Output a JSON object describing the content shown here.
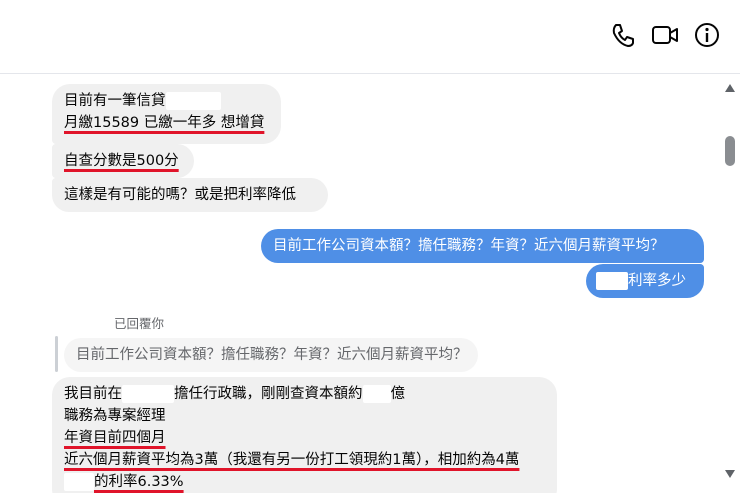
{
  "header": {
    "icons": [
      "phone-icon",
      "video-call-icon",
      "info-icon"
    ]
  },
  "messages": {
    "m1_line1": "目前有一筆信貸",
    "m1_line2": "月繳15589 已繳一年多 想增貸",
    "m2": "自查分數是500分",
    "m3": "這樣是有可能的嗎？或是把利率降低",
    "m4": "目前工作公司資本額？擔任職務？年資？近六個月薪資平均？",
    "m5": "利率多少",
    "replied_label": "已回覆你",
    "quoted": "目前工作公司資本額？擔任職務？年資？近六個月薪資平均？",
    "r_line1_a": "我目前在",
    "r_line1_b": "擔任行政職，剛剛查資本額約",
    "r_line1_c": "億",
    "r_line2": "職務為專案經理",
    "r_line3": "年資目前四個月",
    "r_line4": "近六個月薪資平均為3萬（我還有另一份打工領現約1萬），相加約為4萬",
    "r_line5": "的利率6.33%"
  },
  "colors": {
    "outgoing": "#4f8fe6",
    "incoming": "#f0f0f0",
    "underline": "#e0142a"
  }
}
